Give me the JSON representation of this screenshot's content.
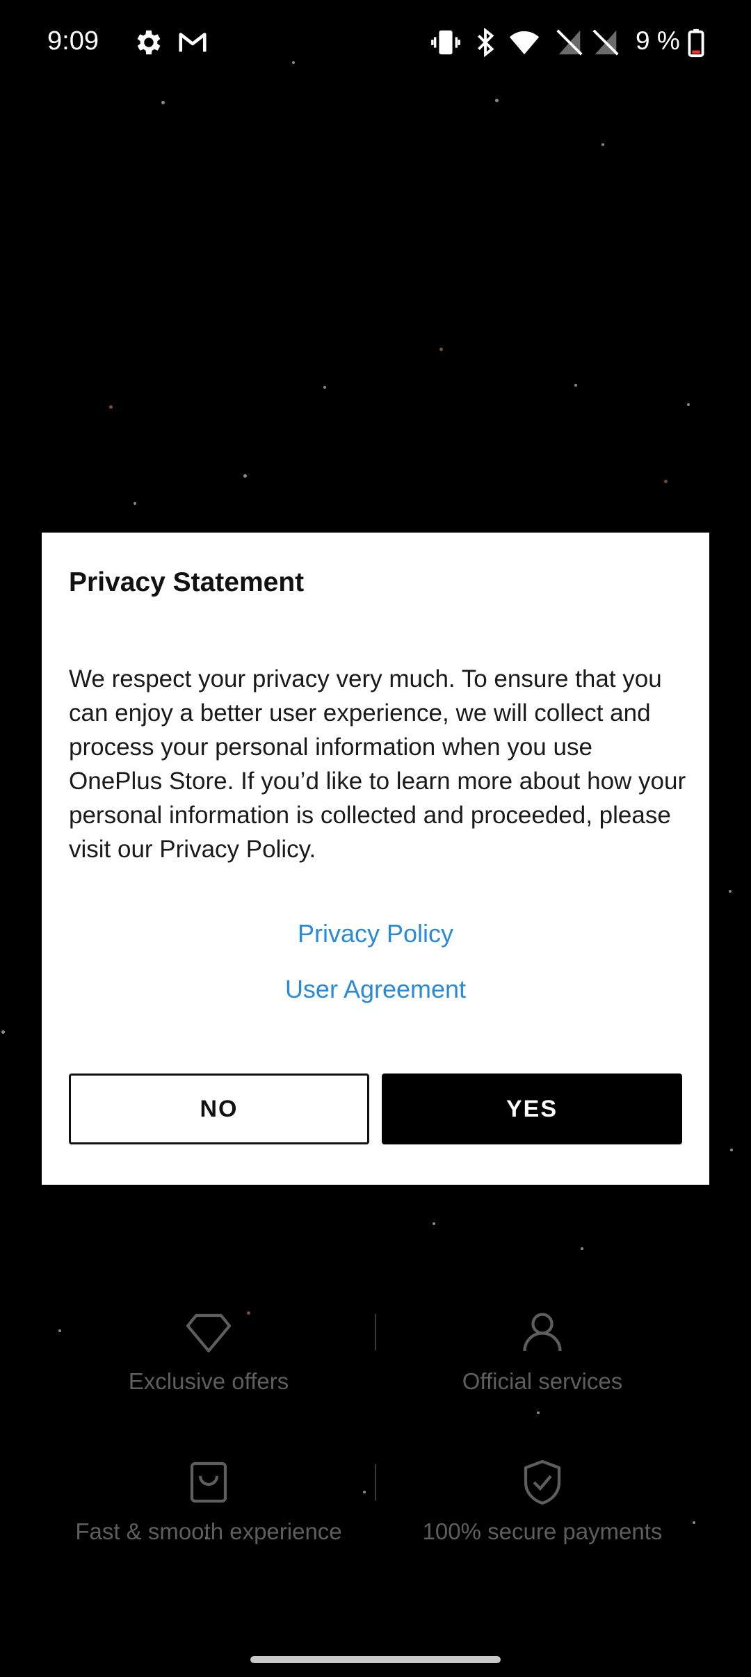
{
  "status_bar": {
    "time": "9:09",
    "battery_text": "9 %",
    "left_icons": [
      "settings-icon",
      "gmail-icon"
    ],
    "right_icons": [
      "vibrate-icon",
      "bluetooth-icon",
      "wifi-icon",
      "no-sim-icon",
      "no-sim-icon",
      "battery-low-icon"
    ]
  },
  "dialog": {
    "title": "Privacy Statement",
    "body": "We respect your privacy very much. To ensure that you can enjoy a better user experience, we will collect and process your personal information when you use OnePlus Store. If you’d like to learn more about how your personal information is collected and proceeded, please visit our Privacy Policy.",
    "privacy_policy_link": "Privacy Policy",
    "user_agreement_link": "User Agreement",
    "no_button": "NO",
    "yes_button": "YES"
  },
  "features": [
    {
      "label": "Exclusive offers",
      "icon": "diamond-icon"
    },
    {
      "label": "Official services",
      "icon": "person-icon"
    },
    {
      "label": "Fast & smooth experience",
      "icon": "shopping-bag-icon"
    },
    {
      "label": "100% secure payments",
      "icon": "shield-check-icon"
    }
  ],
  "colors": {
    "link": "#2a8ad6",
    "background": "#000000",
    "dialog_background": "#ffffff",
    "battery_low": "#e53935"
  }
}
